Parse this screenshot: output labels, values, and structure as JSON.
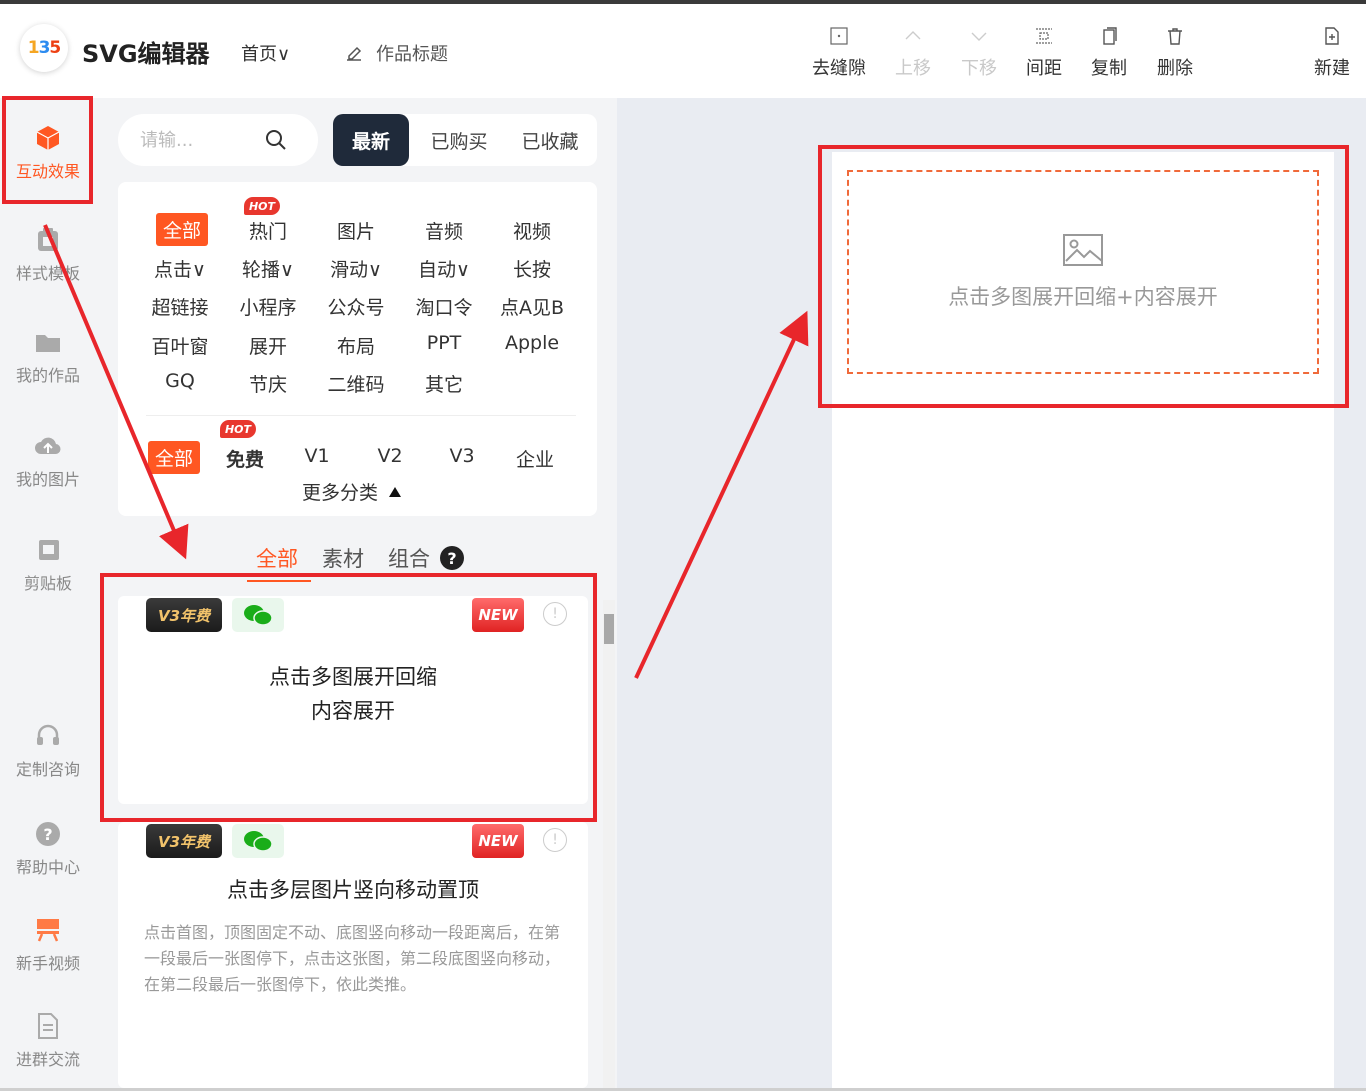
{
  "app": {
    "logo_text_1": "1",
    "logo_text_2": "3",
    "logo_text_3": "5",
    "title": "SVG编辑器",
    "home_label": "首页∨",
    "work_title_label": "作品标题"
  },
  "toolbar": {
    "items": [
      {
        "label": "去缝隙",
        "icon": "grid-dots-icon",
        "disabled": false
      },
      {
        "label": "上移",
        "icon": "chevron-up-icon",
        "disabled": true
      },
      {
        "label": "下移",
        "icon": "chevron-down-icon",
        "disabled": true
      },
      {
        "label": "间距",
        "icon": "spacing-icon",
        "disabled": false
      },
      {
        "label": "复制",
        "icon": "copy-icon",
        "disabled": false
      },
      {
        "label": "删除",
        "icon": "trash-icon",
        "disabled": false
      }
    ],
    "new_label": "新建"
  },
  "sidebar": {
    "items": [
      {
        "label": "互动效果",
        "icon": "cube-icon",
        "active": true
      },
      {
        "label": "样式模板",
        "icon": "template-icon",
        "active": false
      },
      {
        "label": "我的作品",
        "icon": "folder-icon",
        "active": false
      },
      {
        "label": "我的图片",
        "icon": "cloud-upload-icon",
        "active": false
      },
      {
        "label": "剪贴板",
        "icon": "clipboard-icon",
        "active": false
      },
      {
        "label": "定制咨询",
        "icon": "headset-icon",
        "active": false
      },
      {
        "label": "帮助中心",
        "icon": "question-icon",
        "active": false
      },
      {
        "label": "新手视频",
        "icon": "video-icon",
        "active": false
      },
      {
        "label": "进群交流",
        "icon": "document-icon",
        "active": false
      }
    ]
  },
  "search": {
    "placeholder": "请输..."
  },
  "filter_tabs": [
    "最新",
    "已购买",
    "已收藏"
  ],
  "categories": {
    "row1": [
      "全部",
      "热门",
      "图片",
      "音频",
      "视频"
    ],
    "row2": [
      "点击∨",
      "轮播∨",
      "滑动∨",
      "自动∨",
      "长按"
    ],
    "row3": [
      "超链接",
      "小程序",
      "公众号",
      "淘口令",
      "点A见B"
    ],
    "row4": [
      "百叶窗",
      "展开",
      "布局",
      "PPT",
      "Apple"
    ],
    "row5": [
      "GQ",
      "节庆",
      "二维码",
      "其它"
    ],
    "hot_label": "HOT",
    "versions": [
      "全部",
      "免费",
      "V1",
      "V2",
      "V3",
      "企业"
    ],
    "more": "更多分类"
  },
  "subtabs": [
    "全部",
    "素材",
    "组合"
  ],
  "help_mark": "?",
  "cards": [
    {
      "badge": "V3年费",
      "new": "NEW",
      "info": "!",
      "title_line1": "点击多图展开回缩",
      "title_line2": "内容展开"
    },
    {
      "badge": "V3年费",
      "new": "NEW",
      "info": "!",
      "title": "点击多层图片竖向移动置顶",
      "desc": "点击首图，顶图固定不动、底图竖向移动一段距离后，在第一段最后一张图停下，点击这张图，第二段底图竖向移动，在第二段最后一张图停下，依此类推。"
    }
  ],
  "canvas": {
    "placeholder_text": "点击多图展开回缩+内容展开",
    "icon": "image-placeholder-icon"
  },
  "colors": {
    "accent": "#ff5722",
    "annotation_red": "#e8262b",
    "dark_tab": "#1f2a3a"
  }
}
